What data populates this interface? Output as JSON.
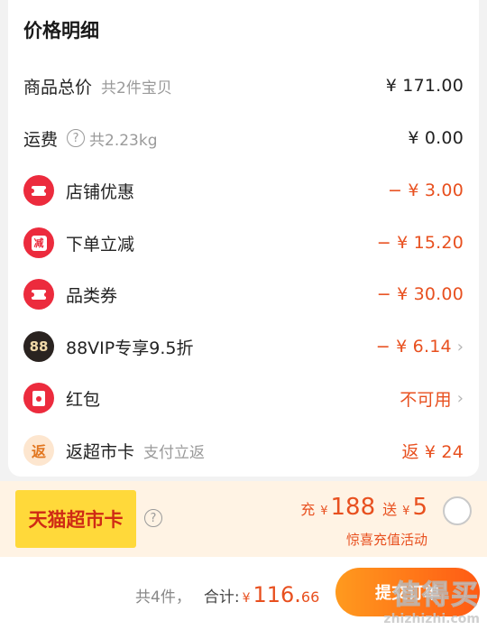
{
  "price_detail": {
    "title": "价格明细",
    "rows": [
      {
        "label": "商品总价",
        "sub": "共2件宝贝",
        "amount": "¥ 171.00"
      },
      {
        "label": "运费",
        "sub": "共2.23kg",
        "amount": "¥ 0.00"
      },
      {
        "label": "店铺优惠",
        "amount": "− ¥ 3.00",
        "icon": "coupon-icon"
      },
      {
        "label": "下单立减",
        "icon_text": "减",
        "amount": "− ¥ 15.20",
        "icon": "instant-discount-icon"
      },
      {
        "label": "品类券",
        "amount": "− ¥ 30.00",
        "icon": "coupon-icon"
      },
      {
        "label": "88VIP专享9.5折",
        "icon_text": "88",
        "amount": "− ¥ 6.14",
        "icon": "vip-88-icon"
      },
      {
        "label": "红包",
        "amount": "不可用",
        "icon": "red-envelope-icon"
      },
      {
        "label": "返超市卡",
        "sub": "支付立返",
        "icon_text": "返",
        "amount": "返 ¥ 24",
        "icon": "rebate-icon"
      }
    ]
  },
  "promo": {
    "card_label": "天猫超市卡",
    "recharge_word": "充",
    "recharge_currency": "¥",
    "recharge_amount": "188",
    "gift_word": "送",
    "gift_currency": "¥",
    "gift_amount": "5",
    "activity_text": "惊喜充值活动"
  },
  "footer": {
    "count_text": "共4件，",
    "total_label": "合计:",
    "currency": "¥",
    "total_int": "116.",
    "total_dec": "66",
    "submit_label": "提交订单"
  },
  "watermark": {
    "logo": "值得买",
    "url": "zhizhizhi.com"
  },
  "colors": {
    "accent": "#e8501f",
    "coupon_red": "#ec2b3d",
    "promo_bg": "#fff3e4",
    "card_yellow": "#ffd93a"
  }
}
